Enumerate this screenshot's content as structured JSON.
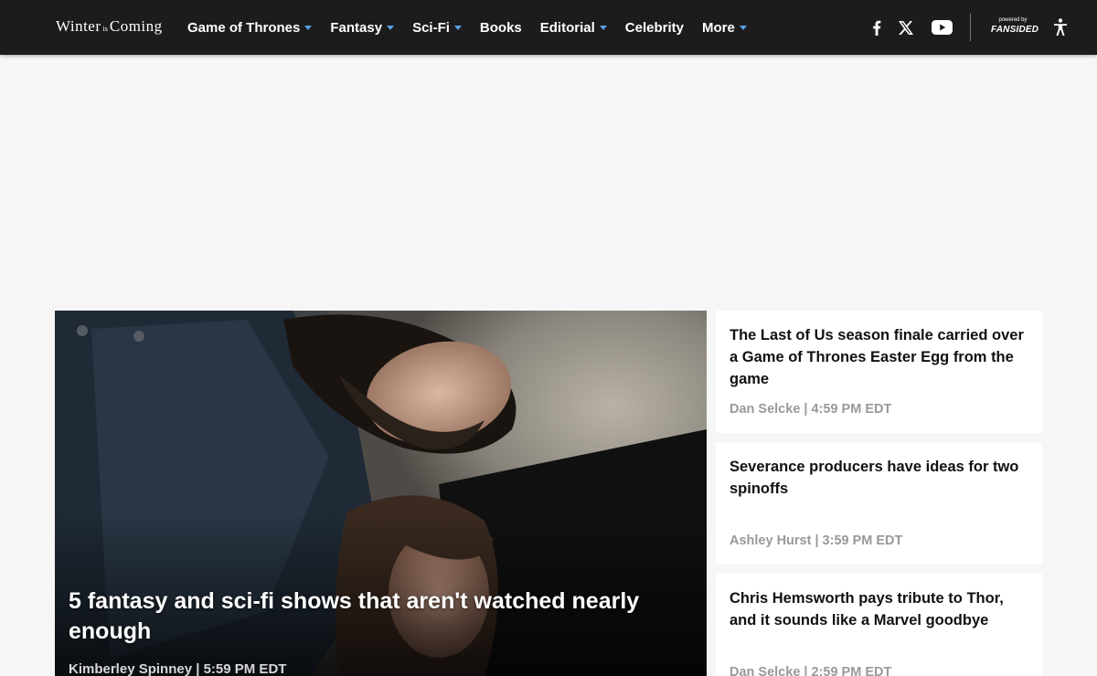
{
  "header": {
    "logo": {
      "word1": "Winter",
      "word2": "is",
      "word3": "Coming"
    },
    "nav": [
      {
        "label": "Game of Thrones",
        "dropdown": true
      },
      {
        "label": "Fantasy",
        "dropdown": true
      },
      {
        "label": "Sci-Fi",
        "dropdown": true
      },
      {
        "label": "Books",
        "dropdown": false
      },
      {
        "label": "Editorial",
        "dropdown": true
      },
      {
        "label": "Celebrity",
        "dropdown": false
      },
      {
        "label": "More",
        "dropdown": true
      }
    ],
    "social_icons": [
      "facebook-icon",
      "x-icon",
      "youtube-icon"
    ],
    "powered_by": {
      "line1": "powered by",
      "brand": "FANSIDED"
    },
    "accessibility_icon": "accessibility-icon"
  },
  "hero": {
    "title": "5 fantasy and sci-fi shows that aren't watched nearly enough",
    "meta": "Kimberley Spinney | 5:59 PM EDT"
  },
  "side_articles": [
    {
      "title": "The Last of Us season finale carried over a Game of Thrones Easter Egg from the game",
      "meta": "Dan Selcke | 4:59 PM EDT"
    },
    {
      "title": "Severance producers have ideas for two spinoffs",
      "meta": "Ashley Hurst | 3:59 PM EDT"
    },
    {
      "title": "Chris Hemsworth pays tribute to Thor, and it sounds like a Marvel goodbye",
      "meta": "Dan Selcke | 2:59 PM EDT"
    }
  ],
  "colors": {
    "header_bg": "#1c1c1c",
    "caret": "#5aa0e6",
    "page_bg": "#f6f6f6",
    "card_bg": "#ffffff",
    "meta_gray": "#999999"
  }
}
